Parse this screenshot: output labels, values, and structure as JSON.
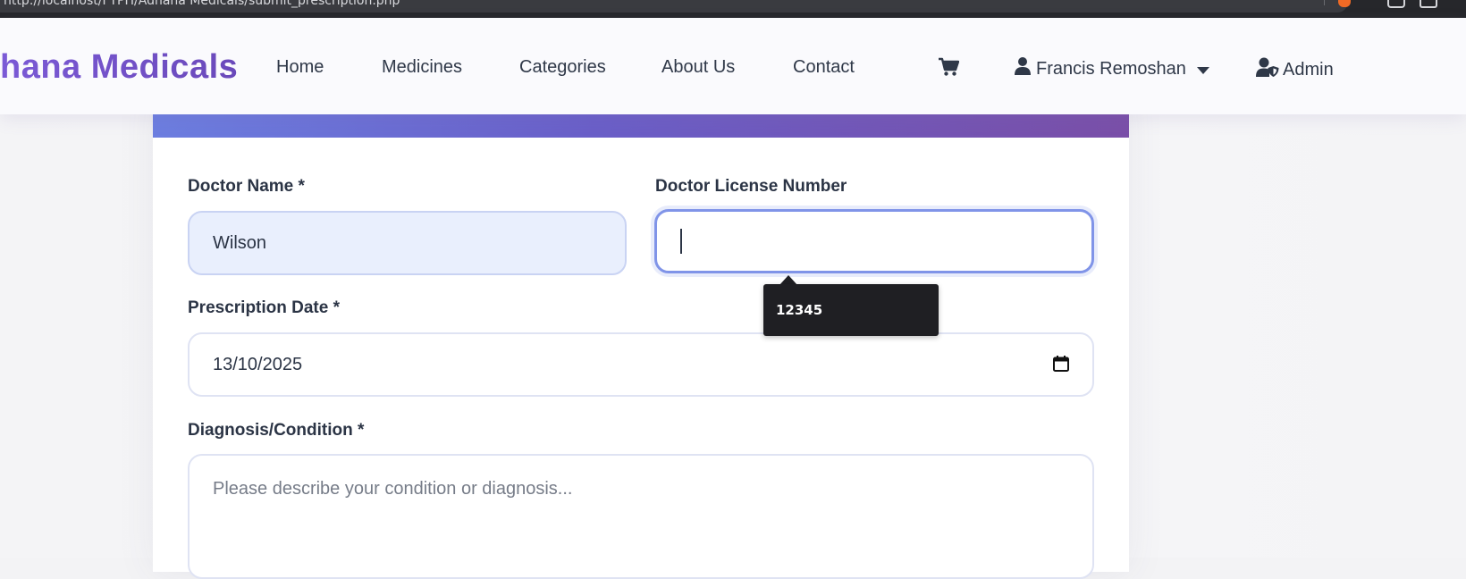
{
  "browser": {
    "url": "http://localhost/FYPH/Adhana Medicals/submit_prescription.php"
  },
  "navbar": {
    "brand": "hana Medicals",
    "links": [
      "Home",
      "Medicines",
      "Categories",
      "About Us",
      "Contact"
    ],
    "cart_icon": "cart-icon",
    "user_name": "Francis Remoshan",
    "admin_label": "Admin"
  },
  "form": {
    "doctor_name": {
      "label": "Doctor Name *",
      "value": "Wilson"
    },
    "doctor_license": {
      "label": "Doctor License Number",
      "value": ""
    },
    "prescription_date": {
      "label": "Prescription Date *",
      "value": "13/10/2025"
    },
    "diagnosis": {
      "label": "Diagnosis/Condition *",
      "placeholder": "Please describe your condition or diagnosis..."
    }
  },
  "autofill": {
    "suggestion": "12345"
  },
  "colors": {
    "brand": "#6c4fc0",
    "header_gradient_start": "#6c7ee0",
    "header_gradient_end": "#7a4fa8",
    "focus_border": "#8094e8"
  }
}
